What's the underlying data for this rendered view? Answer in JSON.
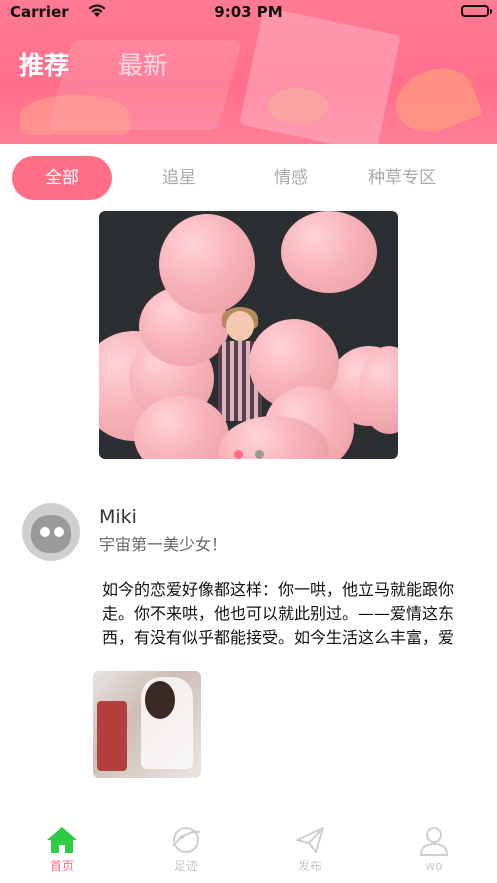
{
  "status_bar": {
    "carrier": "Carrier",
    "time": "9:03 PM"
  },
  "header": {
    "tabs": [
      {
        "label": "推荐",
        "active": true
      },
      {
        "label": "最新",
        "active": false
      }
    ]
  },
  "categories": [
    {
      "label": "全部",
      "active": true
    },
    {
      "label": "追星",
      "active": false
    },
    {
      "label": "情感",
      "active": false
    },
    {
      "label": "种草专区",
      "active": false
    }
  ],
  "banner": {
    "page_count": 2,
    "current_page": 1
  },
  "post": {
    "username": "Miki",
    "signature": "宇宙第一美少女！",
    "text": "如今的恋爱好像都这样：你一哄，他立马就能跟你走。你不来哄，他也可以就此别过。——爱情这东西，有没有似乎都能接受。如今生活这么丰富，爱情已经不是必需品，有你挺好，没你也行"
  },
  "tabbar": [
    {
      "label": "首页",
      "icon": "home-icon",
      "active": true
    },
    {
      "label": "足迹",
      "icon": "planet-icon",
      "active": false
    },
    {
      "label": "发布",
      "icon": "paper-plane-icon",
      "active": false
    },
    {
      "label": "wo",
      "icon": "user-icon",
      "active": false
    }
  ],
  "colors": {
    "accent": "#ff6e85",
    "header": "#ff7a93",
    "active_tab_icon": "#2ecc40"
  }
}
